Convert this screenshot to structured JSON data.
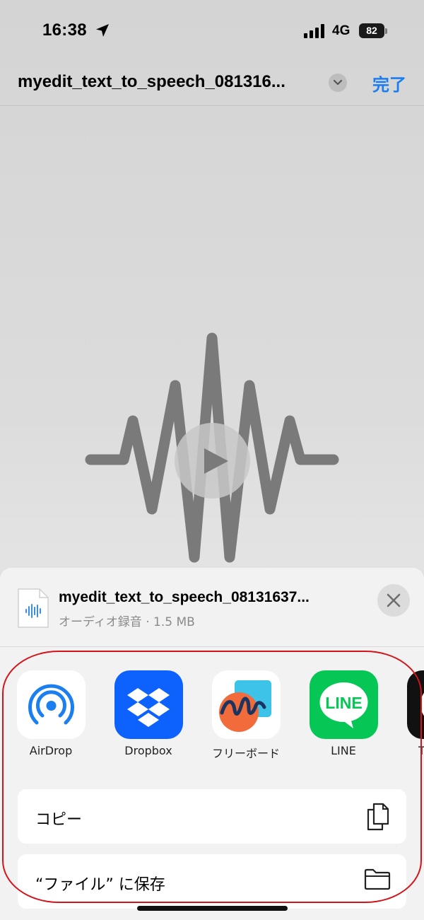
{
  "status_bar": {
    "time": "16:38",
    "network": "4G",
    "battery": "82"
  },
  "nav": {
    "file_title": "myedit_text_to_speech_081316...",
    "done_label": "完了"
  },
  "share_sheet": {
    "file_name": "myedit_text_to_speech_08131637...",
    "file_meta": "オーディオ録音 · 1.5 MB",
    "apps": [
      {
        "label": "AirDrop",
        "icon": "airdrop-icon"
      },
      {
        "label": "Dropbox",
        "icon": "dropbox-icon"
      },
      {
        "label": "フリーボード",
        "icon": "freeform-icon"
      },
      {
        "label": "LINE",
        "icon": "line-icon"
      },
      {
        "label": "T",
        "icon": "partial-app-icon"
      }
    ],
    "line_logo_text": "LINE",
    "actions": [
      {
        "label": "コピー",
        "icon": "copy-icon"
      },
      {
        "label": "“ファイル” に保存",
        "icon": "folder-icon"
      }
    ]
  },
  "colors": {
    "accent": "#1a7ef0",
    "annotation": "#d3141a"
  }
}
